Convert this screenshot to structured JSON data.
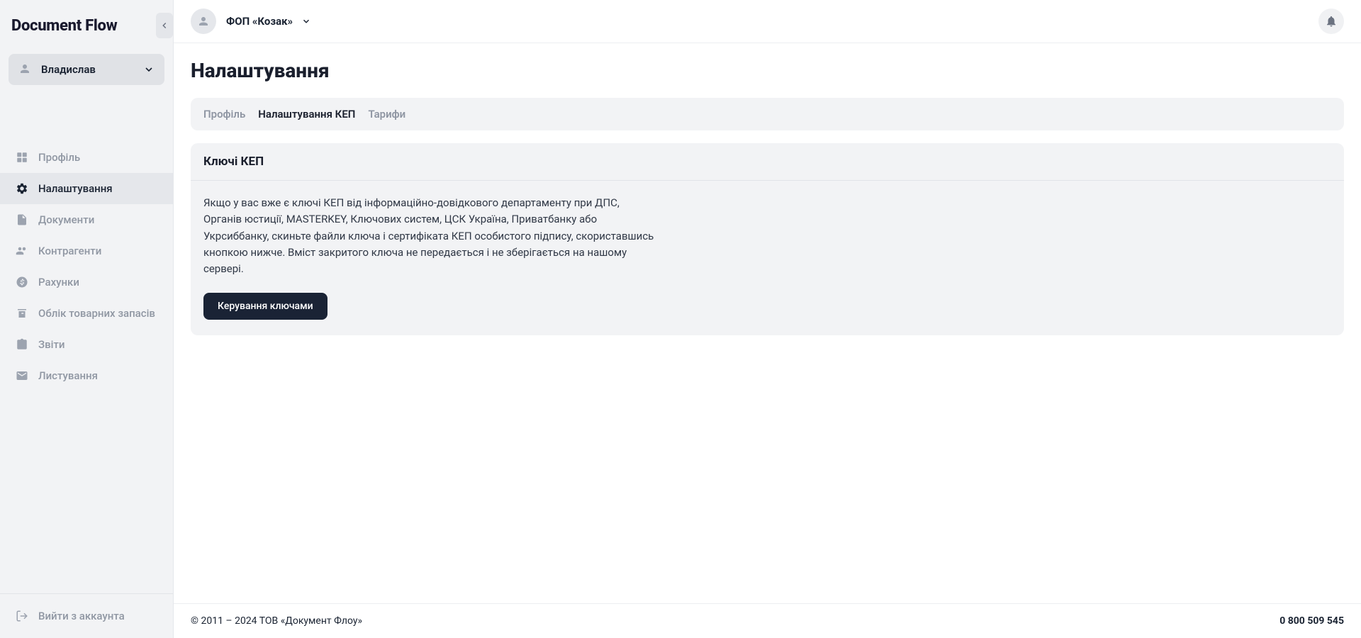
{
  "app": {
    "name": "Document Flow"
  },
  "user": {
    "name": "Владислав"
  },
  "sidebar": {
    "items": [
      {
        "label": "Профіль"
      },
      {
        "label": "Налаштування"
      },
      {
        "label": "Документи"
      },
      {
        "label": "Контрагенти"
      },
      {
        "label": "Рахунки"
      },
      {
        "label": "Облік товарних запасів"
      },
      {
        "label": "Звіти"
      },
      {
        "label": "Листування"
      }
    ],
    "logout": "Вийти з аккаунта"
  },
  "header": {
    "org_name": "ФОП «Козак»"
  },
  "page": {
    "title": "Налаштування",
    "tabs": [
      {
        "label": "Профіль"
      },
      {
        "label": "Налаштування КЕП"
      },
      {
        "label": "Тарифи"
      }
    ],
    "card": {
      "title": "Ключі КЕП",
      "text": "Якщо у вас вже є ключі КЕП від інформаційно-довідкового департаменту при ДПС, Органів юстиції, MASTERKEY, Ключових систем, ЦСК Україна, Приватбанку або Укрсиббанку, скиньте файли ключа і сертифіката КЕП особистого підпису, скориставшись кнопкою нижче. Вміст закритого ключа не передається і не зберігається на нашому сервері.",
      "button": "Керування ключами"
    }
  },
  "footer": {
    "copyright": "© 2011 – 2024 ТОВ «Документ Флоу»",
    "phone": "0 800 509 545"
  }
}
